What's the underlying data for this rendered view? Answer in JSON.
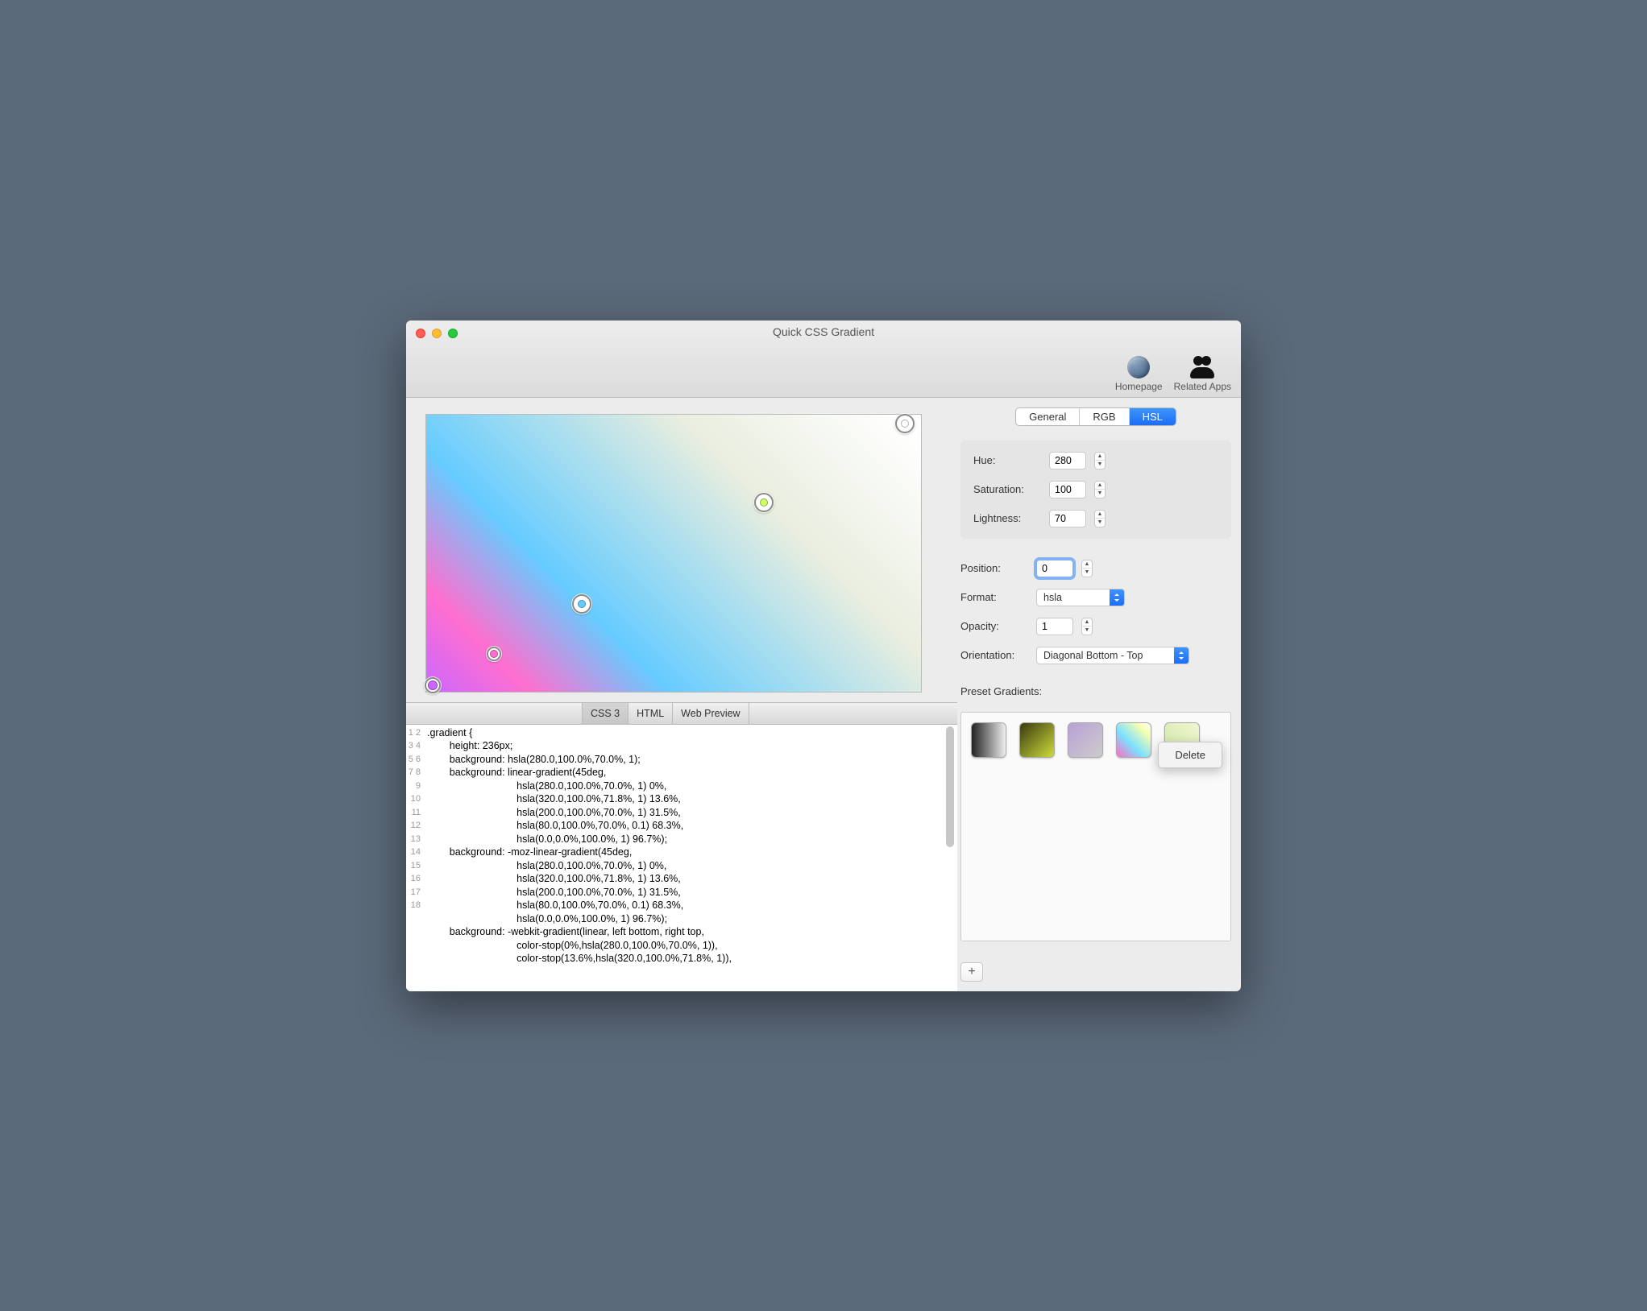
{
  "window": {
    "title": "Quick CSS Gradient"
  },
  "toolbar": {
    "homepage_label": "Homepage",
    "related_apps_label": "Related Apps"
  },
  "color_tabs": {
    "items": [
      "General",
      "RGB",
      "HSL"
    ],
    "active": "HSL"
  },
  "hsl": {
    "hue_label": "Hue:",
    "hue_value": "280",
    "sat_label": "Saturation:",
    "sat_value": "100",
    "light_label": "Lightness:",
    "light_value": "70"
  },
  "stop_props": {
    "position_label": "Position:",
    "position_value": "0",
    "format_label": "Format:",
    "format_value": "hsla",
    "opacity_label": "Opacity:",
    "opacity_value": "1",
    "orientation_label": "Orientation:",
    "orientation_value": "Diagonal Bottom - Top"
  },
  "presets": {
    "label": "Preset Gradients:",
    "context_delete": "Delete",
    "add_label": "+"
  },
  "code_tabs": {
    "items": [
      "CSS 3",
      "HTML",
      "Web Preview"
    ],
    "active": "CSS 3"
  },
  "code_lines": [
    ".gradient {",
    "        height: 236px;",
    "        background: hsla(280.0,100.0%,70.0%, 1);",
    "        background: linear-gradient(45deg,",
    "                                hsla(280.0,100.0%,70.0%, 1) 0%,",
    "                                hsla(320.0,100.0%,71.8%, 1) 13.6%,",
    "                                hsla(200.0,100.0%,70.0%, 1) 31.5%,",
    "                                hsla(80.0,100.0%,70.0%, 0.1) 68.3%,",
    "                                hsla(0.0,0.0%,100.0%, 1) 96.7%);",
    "        background: -moz-linear-gradient(45deg,",
    "                                hsla(280.0,100.0%,70.0%, 1) 0%,",
    "                                hsla(320.0,100.0%,71.8%, 1) 13.6%,",
    "                                hsla(200.0,100.0%,70.0%, 1) 31.5%,",
    "                                hsla(80.0,100.0%,70.0%, 0.1) 68.3%,",
    "                                hsla(0.0,0.0%,100.0%, 1) 96.7%);",
    "        background: -webkit-gradient(linear, left bottom, right top,",
    "                                color-stop(0%,hsla(280.0,100.0%,70.0%, 1)),",
    "                                color-stop(13.6%,hsla(320.0,100.0%,71.8%, 1)),"
  ],
  "gradient_stops": [
    {
      "pos": 0.0,
      "color": "hsla(280,100%,70%,1)"
    },
    {
      "pos": 0.136,
      "color": "hsla(320,100%,71.8%,1)"
    },
    {
      "pos": 0.315,
      "color": "hsla(200,100%,70%,1)"
    },
    {
      "pos": 0.683,
      "color": "hsla(80,100%,70%,0.1)"
    },
    {
      "pos": 0.967,
      "color": "hsla(0,0%,100%,1)"
    }
  ]
}
